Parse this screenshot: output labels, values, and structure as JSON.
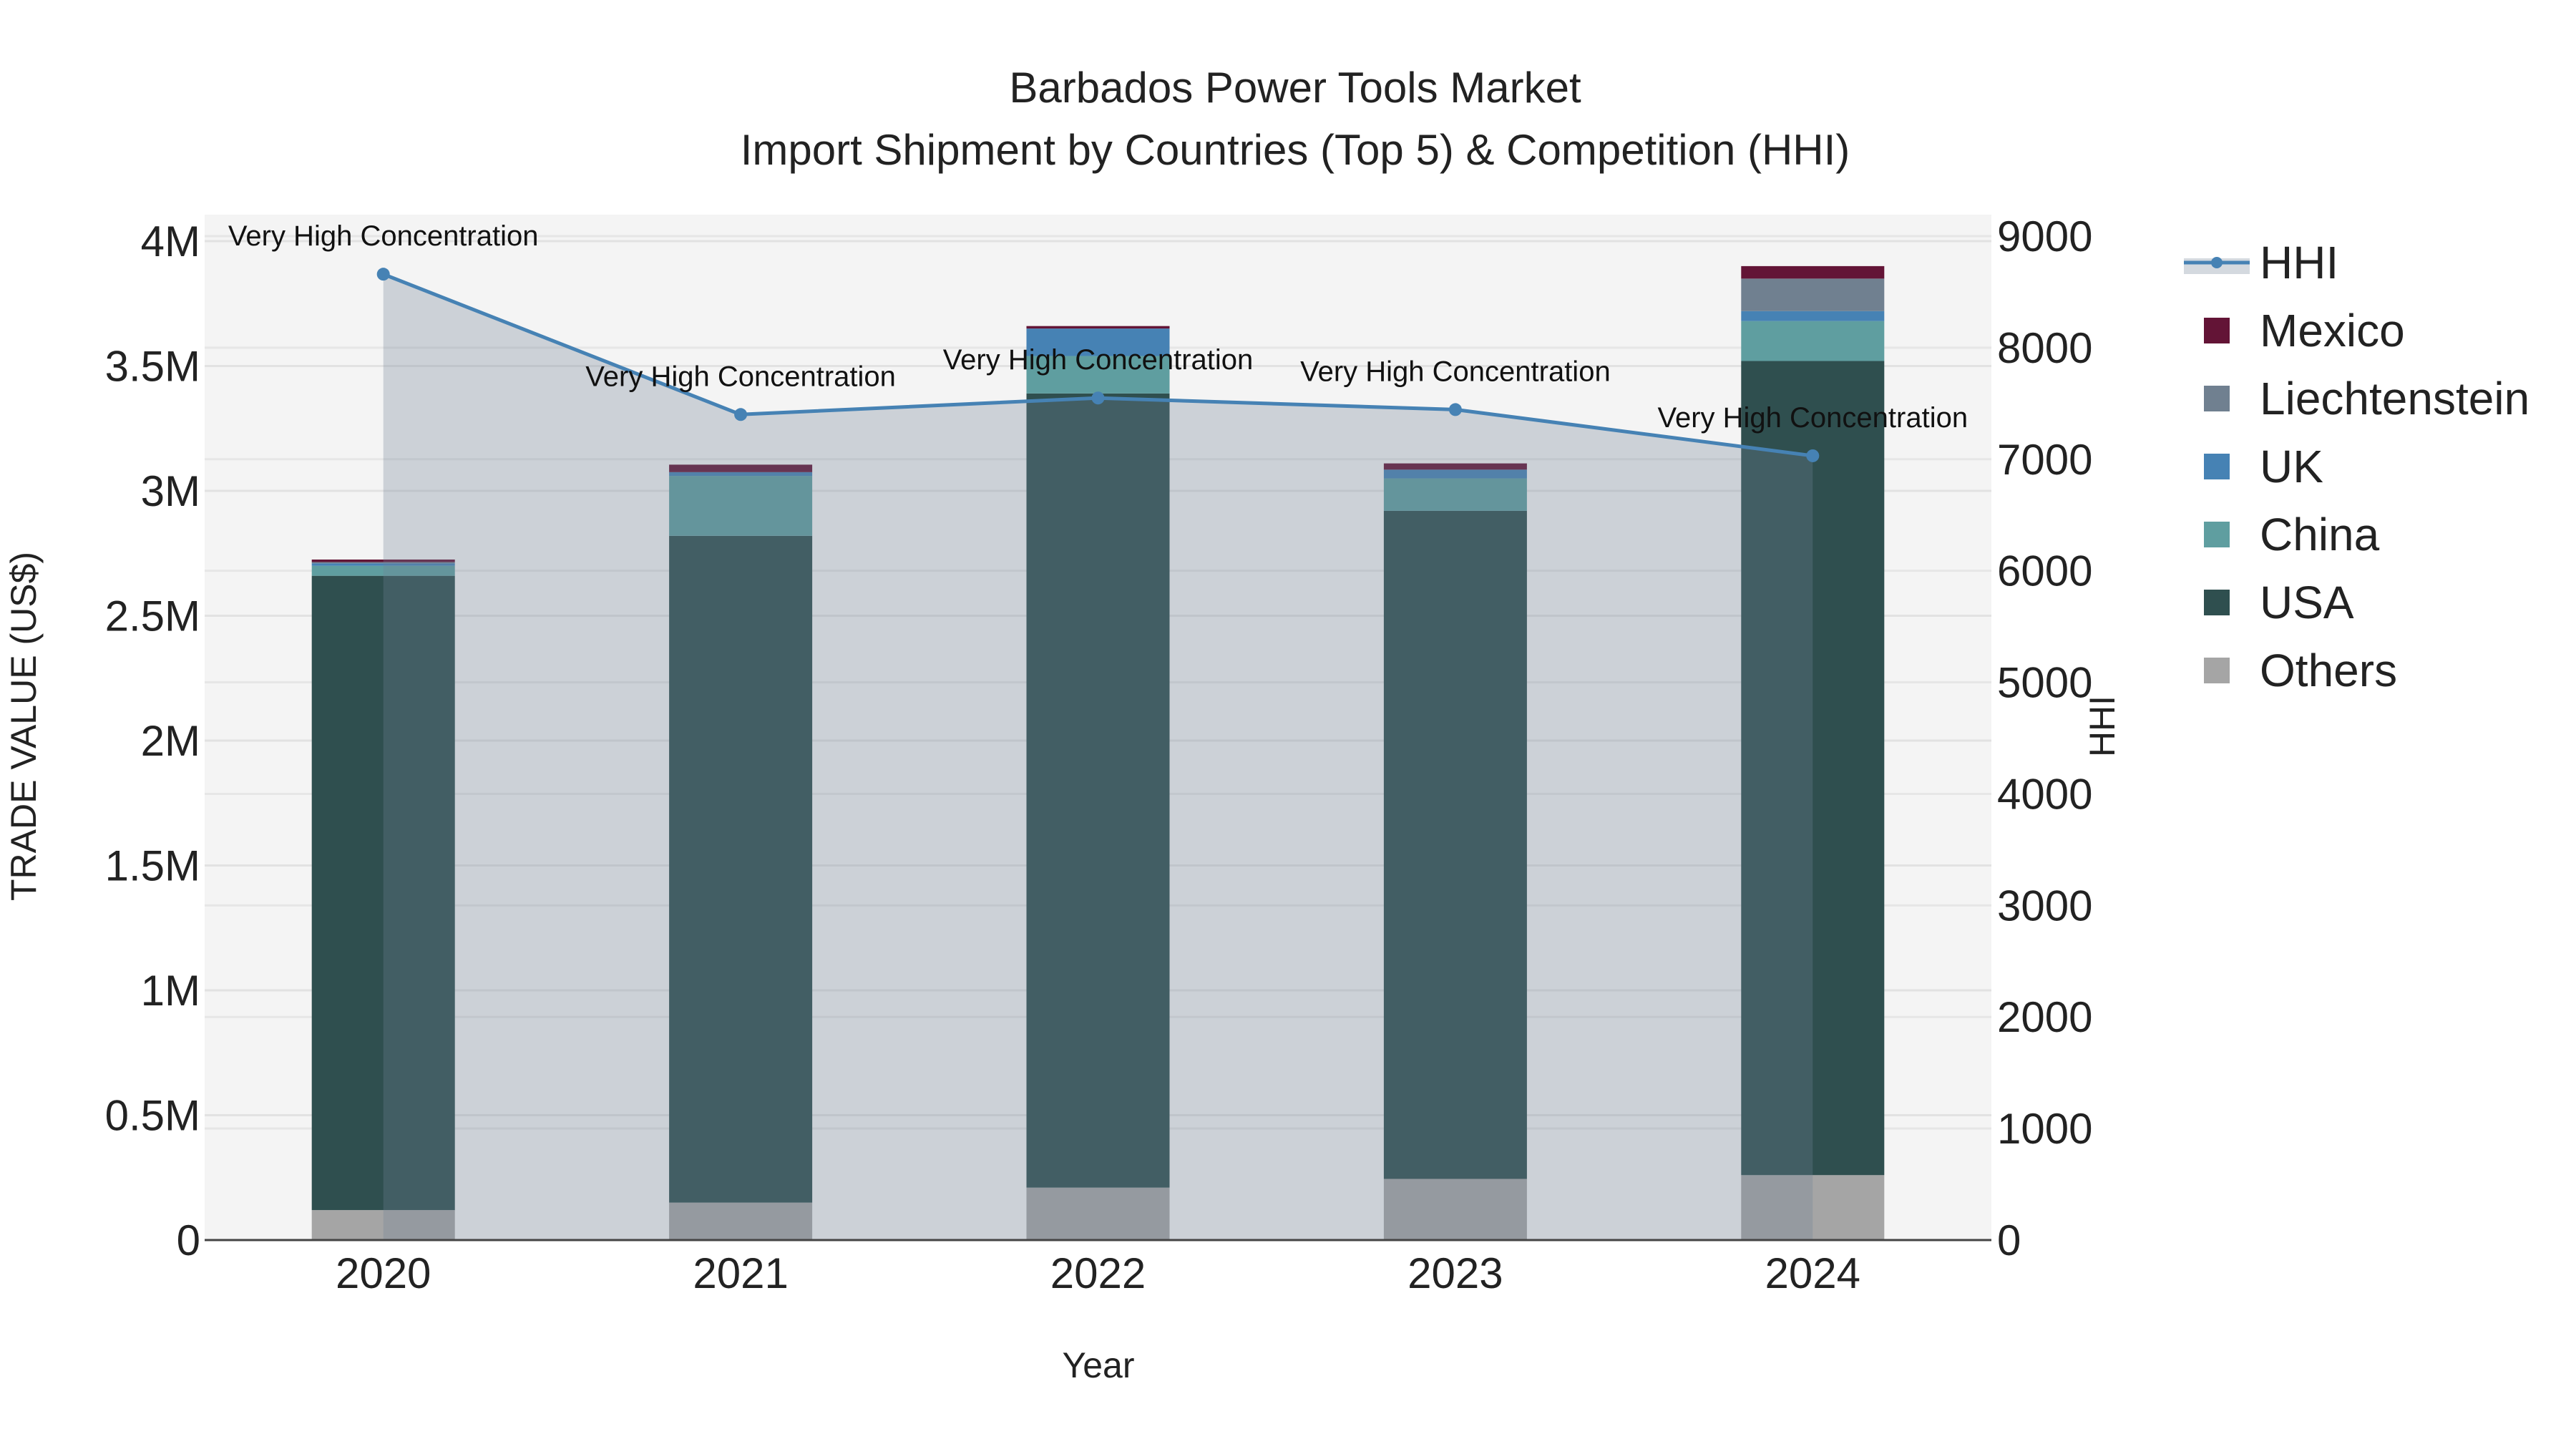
{
  "chart_data": {
    "type": "bar",
    "title": "Barbados Power Tools Market",
    "subtitle": "Import Shipment by Countries (Top 5) & Competition (HHI)",
    "xlabel": "Year",
    "ylabel": "TRADE VALUE (US$)",
    "y2label": "HHI",
    "categories": [
      "2020",
      "2021",
      "2022",
      "2023",
      "2024"
    ],
    "ylim": [
      0,
      4000000
    ],
    "y_ticks": [
      0,
      500000,
      1000000,
      1500000,
      2000000,
      2500000,
      3000000,
      3500000,
      4000000
    ],
    "y_tick_labels": [
      "0",
      "0.5M",
      "1M",
      "1.5M",
      "2M",
      "2.5M",
      "3M",
      "3.5M",
      "4M"
    ],
    "y2lim": [
      0,
      9000
    ],
    "y2_ticks": [
      0,
      1000,
      2000,
      3000,
      4000,
      5000,
      6000,
      7000,
      8000,
      9000
    ],
    "y2_tick_labels": [
      "0",
      "1000",
      "2000",
      "3000",
      "4000",
      "5000",
      "6000",
      "7000",
      "8000",
      "9000"
    ],
    "series": [
      {
        "name": "Others",
        "color": "#a5a5a5",
        "values": [
          120000,
          150000,
          210000,
          245000,
          260000
        ]
      },
      {
        "name": "USA",
        "color": "#2f4f4f",
        "values": [
          2540000,
          2670000,
          3180000,
          2675000,
          3260000
        ]
      },
      {
        "name": "China",
        "color": "#5f9ea0",
        "values": [
          40000,
          240000,
          150000,
          130000,
          160000
        ]
      },
      {
        "name": "UK",
        "color": "#4682b4",
        "values": [
          10000,
          15000,
          110000,
          35000,
          40000
        ]
      },
      {
        "name": "Liechtenstein",
        "color": "#708090",
        "values": [
          5000,
          0,
          0,
          0,
          130000
        ]
      },
      {
        "name": "Mexico",
        "color": "#631436",
        "values": [
          10000,
          30000,
          10000,
          25000,
          50000
        ]
      }
    ],
    "hhi": {
      "name": "HHI",
      "color": "#4682b4",
      "values": [
        8659,
        7401,
        7549,
        7445,
        7031
      ],
      "annotations": [
        "Very High Concentration",
        "Very High Concentration",
        "Very High Concentration",
        "Very High Concentration",
        "Very High Concentration"
      ]
    },
    "legend": [
      "HHI",
      "Mexico",
      "Liechtenstein",
      "UK",
      "China",
      "USA",
      "Others"
    ],
    "legend_position": "right",
    "grid": true
  }
}
